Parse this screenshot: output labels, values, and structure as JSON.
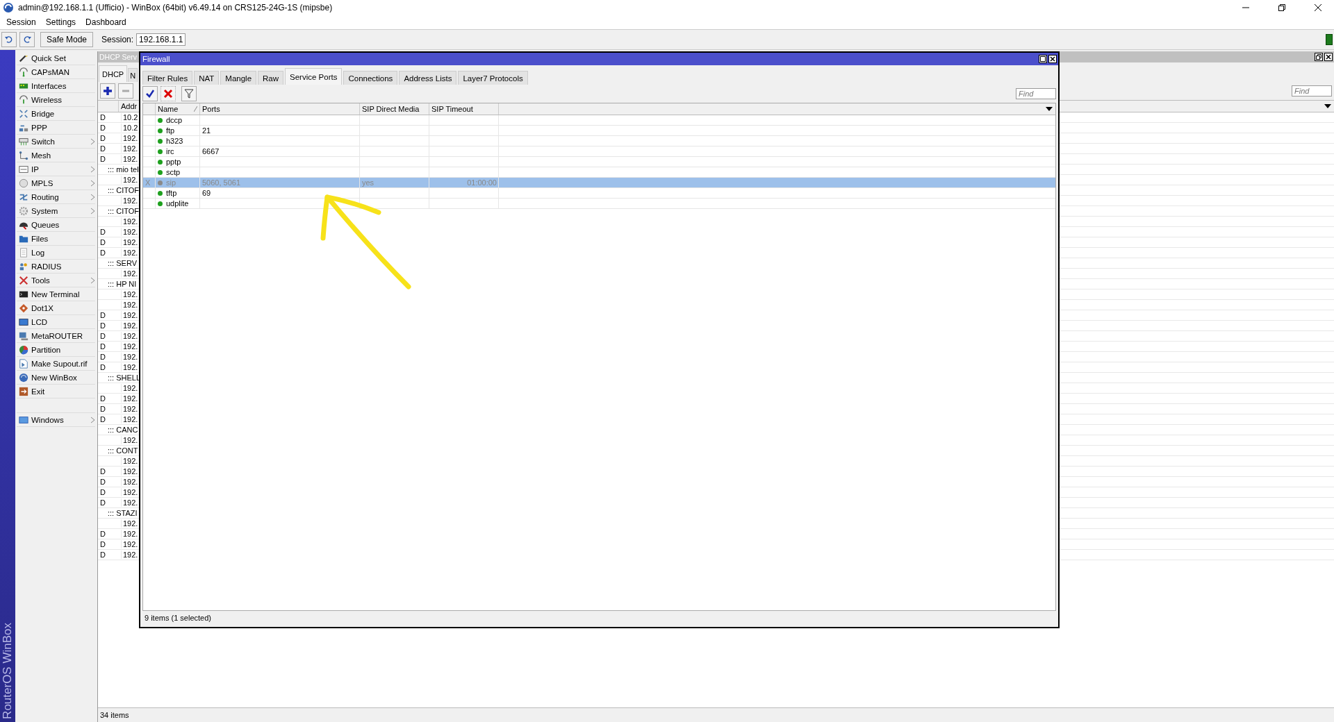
{
  "window": {
    "title": "admin@192.168.1.1 (Ufficio) - WinBox (64bit) v6.49.14 on CRS125-24G-1S (mipsbe)"
  },
  "menu": [
    "Session",
    "Settings",
    "Dashboard"
  ],
  "toolbar": {
    "safe_mode": "Safe Mode",
    "session_label": "Session:",
    "session_value": "192.168.1.1"
  },
  "brand": "RouterOS WinBox",
  "sidebar": {
    "items": [
      {
        "label": "Quick Set",
        "submenu": false
      },
      {
        "label": "CAPsMAN",
        "submenu": false
      },
      {
        "label": "Interfaces",
        "submenu": false
      },
      {
        "label": "Wireless",
        "submenu": false
      },
      {
        "label": "Bridge",
        "submenu": false
      },
      {
        "label": "PPP",
        "submenu": false
      },
      {
        "label": "Switch",
        "submenu": true
      },
      {
        "label": "Mesh",
        "submenu": false
      },
      {
        "label": "IP",
        "submenu": true
      },
      {
        "label": "MPLS",
        "submenu": true
      },
      {
        "label": "Routing",
        "submenu": true
      },
      {
        "label": "System",
        "submenu": true
      },
      {
        "label": "Queues",
        "submenu": false
      },
      {
        "label": "Files",
        "submenu": false
      },
      {
        "label": "Log",
        "submenu": false
      },
      {
        "label": "RADIUS",
        "submenu": false
      },
      {
        "label": "Tools",
        "submenu": true
      },
      {
        "label": "New Terminal",
        "submenu": false
      },
      {
        "label": "Dot1X",
        "submenu": false
      },
      {
        "label": "LCD",
        "submenu": false
      },
      {
        "label": "MetaROUTER",
        "submenu": false
      },
      {
        "label": "Partition",
        "submenu": false
      },
      {
        "label": "Make Supout.rif",
        "submenu": false
      },
      {
        "label": "New WinBox",
        "submenu": false
      },
      {
        "label": "Exit",
        "submenu": false
      }
    ],
    "windows_item": {
      "label": "Windows",
      "submenu": true
    }
  },
  "dhcp_window": {
    "title": "DHCP Serv",
    "tabs": [
      {
        "label": "DHCP",
        "selected": true
      },
      {
        "label": "N",
        "selected": false
      }
    ],
    "find_placeholder": "Find",
    "column": "Addr",
    "rows": [
      {
        "kind": "lease",
        "flag": "D",
        "address": "10.2"
      },
      {
        "kind": "lease",
        "flag": "D",
        "address": "10.2"
      },
      {
        "kind": "lease",
        "flag": "D",
        "address": "192."
      },
      {
        "kind": "lease",
        "flag": "D",
        "address": "192."
      },
      {
        "kind": "lease",
        "flag": "D",
        "address": "192."
      },
      {
        "kind": "comment",
        "text": "::: mio tel"
      },
      {
        "kind": "lease",
        "address": "192."
      },
      {
        "kind": "comment",
        "text": "::: CITOF"
      },
      {
        "kind": "lease",
        "address": "192."
      },
      {
        "kind": "comment",
        "text": "::: CITOF"
      },
      {
        "kind": "lease",
        "address": "192."
      },
      {
        "kind": "lease",
        "flag": "D",
        "address": "192."
      },
      {
        "kind": "lease",
        "flag": "D",
        "address": "192."
      },
      {
        "kind": "lease",
        "flag": "D",
        "address": "192."
      },
      {
        "kind": "comment",
        "text": "::: SERV"
      },
      {
        "kind": "lease",
        "address": "192."
      },
      {
        "kind": "comment",
        "text": "::: HP NI"
      },
      {
        "kind": "lease",
        "address": "192."
      },
      {
        "kind": "lease",
        "address": "192."
      },
      {
        "kind": "lease",
        "flag": "D",
        "address": "192."
      },
      {
        "kind": "lease",
        "flag": "D",
        "address": "192."
      },
      {
        "kind": "lease",
        "flag": "D",
        "address": "192."
      },
      {
        "kind": "lease",
        "flag": "D",
        "address": "192."
      },
      {
        "kind": "lease",
        "flag": "D",
        "address": "192."
      },
      {
        "kind": "lease",
        "flag": "D",
        "address": "192."
      },
      {
        "kind": "comment",
        "text": "::: SHELL"
      },
      {
        "kind": "lease",
        "address": "192."
      },
      {
        "kind": "lease",
        "flag": "D",
        "address": "192."
      },
      {
        "kind": "lease",
        "flag": "D",
        "address": "192."
      },
      {
        "kind": "lease",
        "flag": "D",
        "address": "192."
      },
      {
        "kind": "comment",
        "text": "::: CANC"
      },
      {
        "kind": "lease",
        "address": "192."
      },
      {
        "kind": "comment",
        "text": "::: CONT"
      },
      {
        "kind": "lease",
        "address": "192."
      },
      {
        "kind": "lease",
        "flag": "D",
        "address": "192."
      },
      {
        "kind": "lease",
        "flag": "D",
        "address": "192."
      },
      {
        "kind": "lease",
        "flag": "D",
        "address": "192."
      },
      {
        "kind": "lease",
        "flag": "D",
        "address": "192."
      },
      {
        "kind": "comment",
        "text": "::: STAZI"
      },
      {
        "kind": "lease",
        "address": "192."
      },
      {
        "kind": "lease",
        "flag": "D",
        "address": "192."
      },
      {
        "kind": "lease",
        "flag": "D",
        "address": "192."
      },
      {
        "kind": "lease",
        "flag": "D",
        "address": "192."
      }
    ],
    "status": "34 items"
  },
  "firewall_window": {
    "title": "Firewall",
    "tabs": [
      {
        "label": "Filter Rules",
        "selected": false
      },
      {
        "label": "NAT",
        "selected": false
      },
      {
        "label": "Mangle",
        "selected": false
      },
      {
        "label": "Raw",
        "selected": false
      },
      {
        "label": "Service Ports",
        "selected": true
      },
      {
        "label": "Connections",
        "selected": false
      },
      {
        "label": "Address Lists",
        "selected": false
      },
      {
        "label": "Layer7 Protocols",
        "selected": false
      }
    ],
    "find_placeholder": "Find",
    "columns": [
      "Name",
      "Ports",
      "SIP Direct Media",
      "SIP Timeout"
    ],
    "rows": [
      {
        "name": "dccp",
        "disabled": false,
        "selected": false
      },
      {
        "name": "ftp",
        "ports": "21",
        "disabled": false,
        "selected": false
      },
      {
        "name": "h323",
        "disabled": false,
        "selected": false
      },
      {
        "name": "irc",
        "ports": "6667",
        "disabled": false,
        "selected": false
      },
      {
        "name": "pptp",
        "disabled": false,
        "selected": false
      },
      {
        "name": "sctp",
        "disabled": false,
        "selected": false
      },
      {
        "flag": "X",
        "name": "sip",
        "ports": "5060, 5061",
        "sip_direct_media": "yes",
        "sip_timeout": "01:00:00",
        "disabled": true,
        "selected": true
      },
      {
        "name": "tftp",
        "ports": "69",
        "disabled": false,
        "selected": false
      },
      {
        "name": "udplite",
        "disabled": false,
        "selected": false
      }
    ],
    "status": "9 items (1 selected)"
  }
}
